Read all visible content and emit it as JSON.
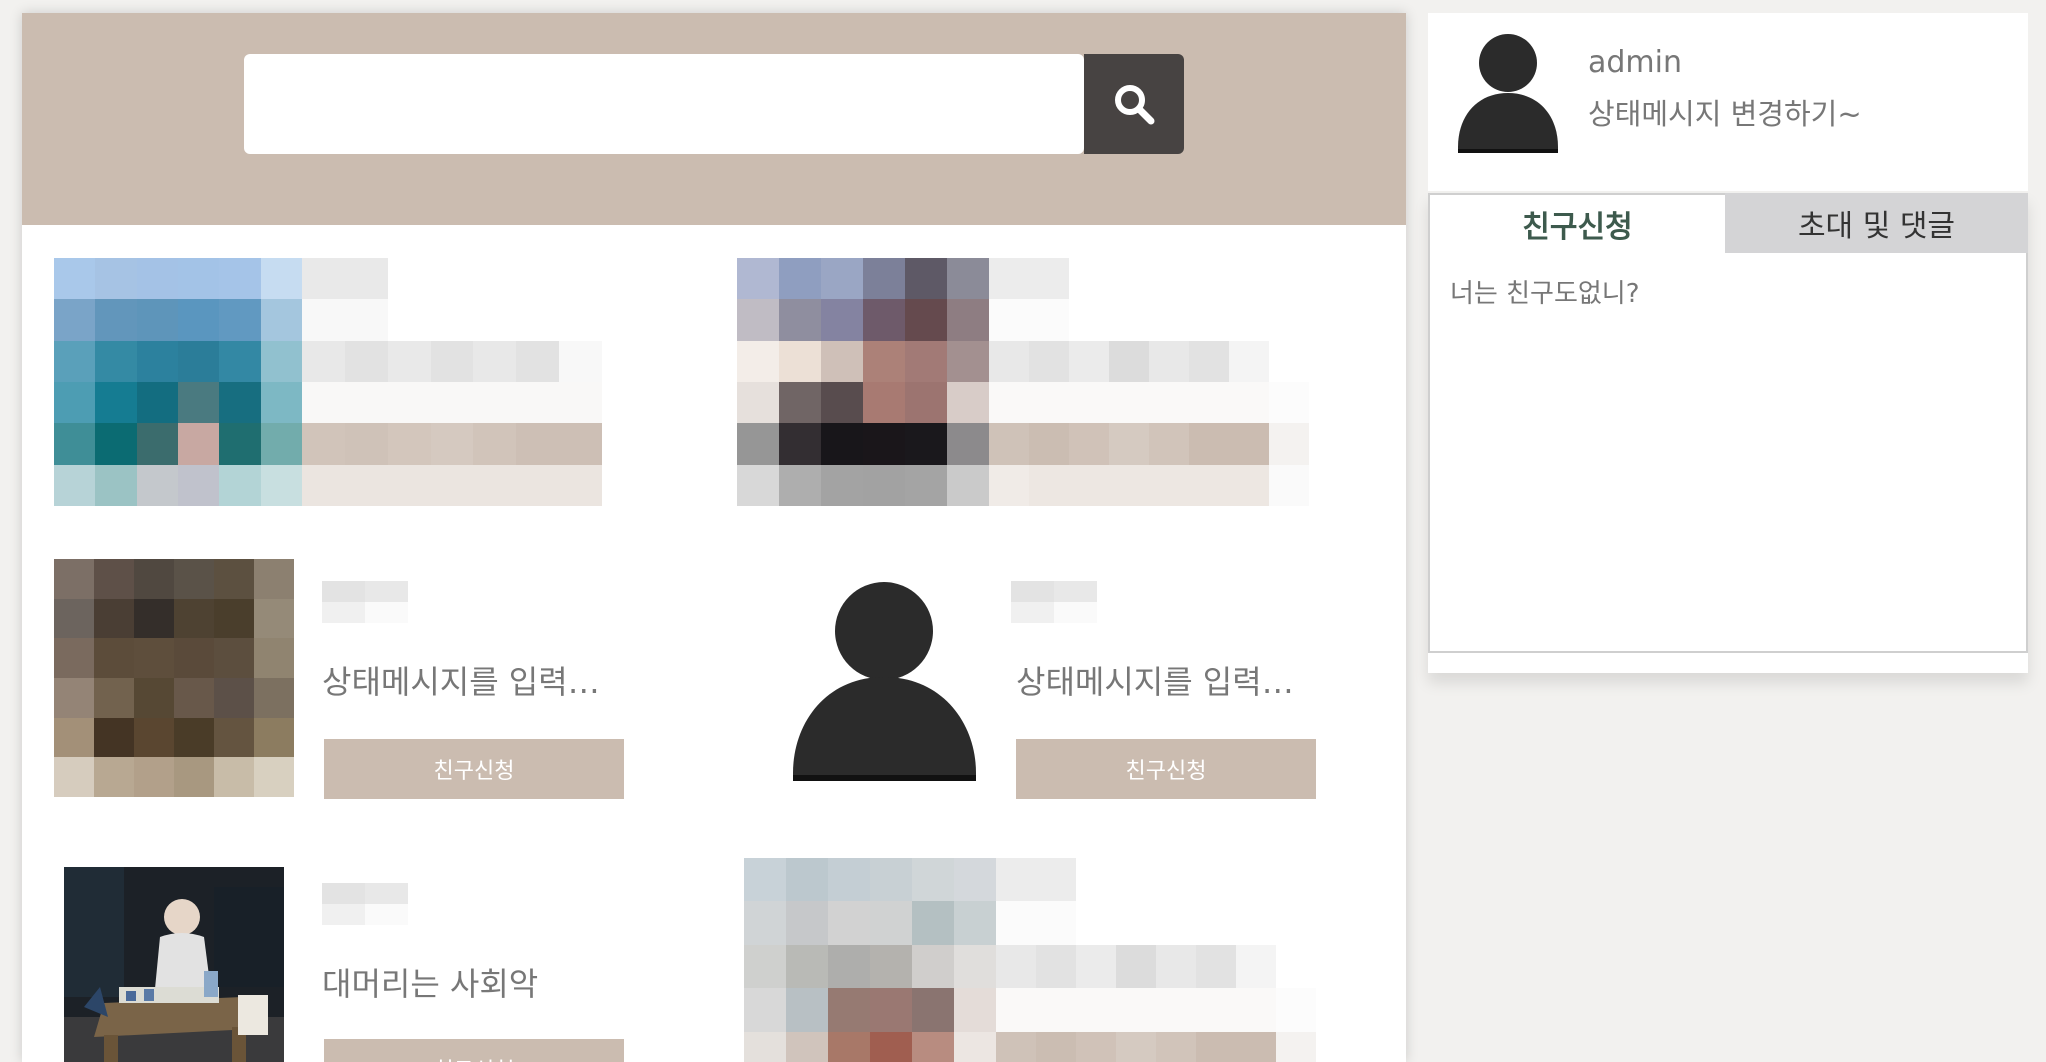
{
  "search": {
    "value": "",
    "placeholder": ""
  },
  "profile": {
    "name": "admin",
    "status": "상태메시지 변경하기~"
  },
  "side_tabs": {
    "tabs": [
      {
        "label": "친구신청",
        "active": true
      },
      {
        "label": "초대 및 댓글",
        "active": false
      }
    ],
    "message": "너는 친구도없니?"
  },
  "users": [
    {
      "status": "",
      "button": ""
    },
    {
      "status": "",
      "button": ""
    },
    {
      "status": "상태메시지를 입력해주세요",
      "button": "친구신청"
    },
    {
      "status": "상태메시지를 입력해주세요",
      "button": "친구신청"
    },
    {
      "status": "대머리는 사회악",
      "button": "친구신청"
    },
    {
      "status": "",
      "button": ""
    }
  ],
  "colors": {
    "page_bg": "#f2f1ef",
    "accent": "#cbbcb0",
    "search_button": "#474342",
    "active_tab_text": "#3d5a4d",
    "inactive_tab_bg": "#d4d4d6"
  },
  "icons": {
    "search": "search-icon",
    "avatar": "default-avatar-icon"
  }
}
